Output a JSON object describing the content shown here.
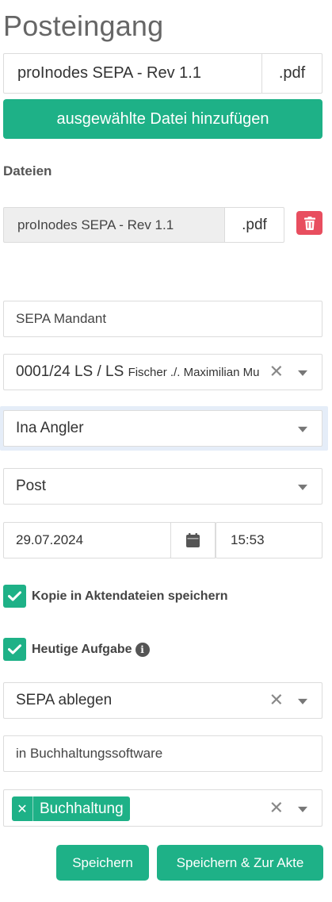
{
  "page": {
    "title": "Posteingang"
  },
  "upload": {
    "file_name": "proInodes SEPA - Rev 1.1",
    "file_ext": ".pdf",
    "add_button_label": "ausgewählte Datei hinzufügen"
  },
  "files": {
    "heading": "Dateien",
    "items": [
      {
        "name": "proInodes SEPA - Rev 1.1",
        "ext": ".pdf",
        "delete_icon": "trash-icon"
      }
    ]
  },
  "form": {
    "subject": "SEPA Mandant",
    "case_select": {
      "main": "0001/24 LS / LS",
      "secondary": "Fischer ./. Maximilian Mu",
      "clear_icon": "close-icon",
      "caret_icon": "caret-down-icon"
    },
    "user_select": {
      "value": "Ina Angler",
      "caret_icon": "caret-down-icon"
    },
    "channel_select": {
      "value": "Post",
      "caret_icon": "caret-down-icon"
    },
    "date": "29.07.2024",
    "calendar_icon": "calendar-icon",
    "time": "15:53",
    "copy_checkbox": {
      "label": "Kopie in Aktendateien speichern",
      "checked": true
    },
    "task_checkbox": {
      "label": "Heutige Aufgabe",
      "checked": true,
      "info_icon": "info-icon"
    },
    "task_select": {
      "value": "SEPA ablegen",
      "clear_icon": "close-icon",
      "caret_icon": "caret-down-icon"
    },
    "task_note": "in Buchhaltungssoftware",
    "tags_select": {
      "tags": [
        "Buchhaltung"
      ],
      "clear_icon": "close-icon",
      "caret_icon": "caret-down-icon"
    }
  },
  "actions": {
    "save_label": "Speichern",
    "save_and_open_label": "Speichern & Zur Akte"
  },
  "colors": {
    "accent": "#1eb187",
    "danger": "#e84e5f",
    "focus_bg": "#e5edf8"
  }
}
